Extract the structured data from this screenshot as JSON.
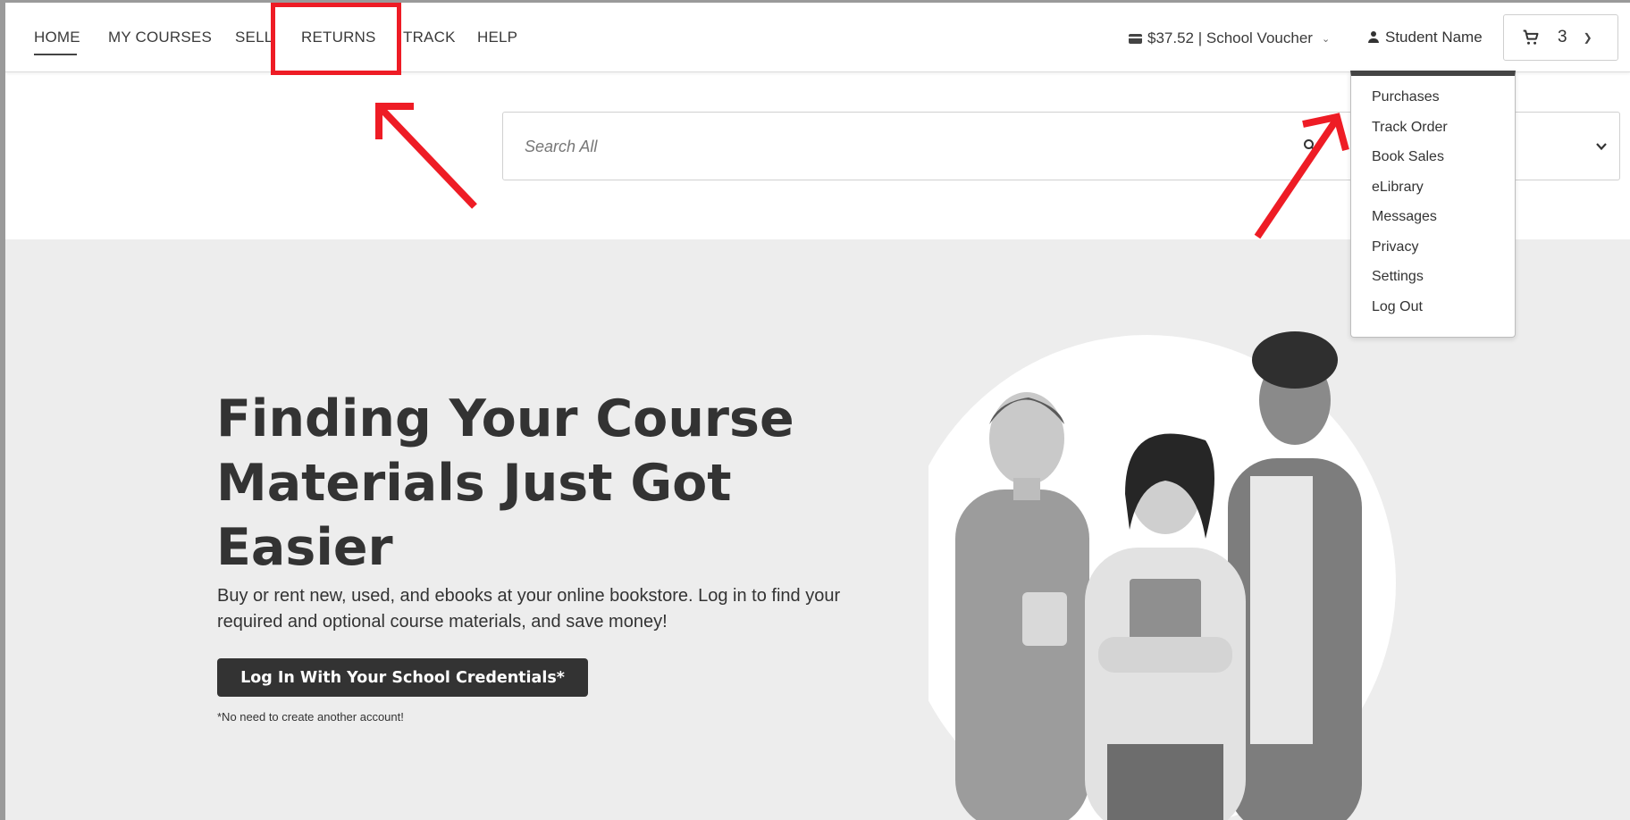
{
  "nav": {
    "items": [
      {
        "label": "HOME"
      },
      {
        "label": "MY COURSES"
      },
      {
        "label": "SELL"
      },
      {
        "label": "RETURNS"
      },
      {
        "label": "TRACK"
      },
      {
        "label": "HELP"
      }
    ],
    "active": "HOME"
  },
  "account": {
    "voucher_label": "$37.52 | School Voucher",
    "user_name": "Student Name",
    "cart_count": "3",
    "icons": [
      "card-icon",
      "person-icon",
      "cart-icon",
      "chevron-down-icon"
    ]
  },
  "user_menu": {
    "items": [
      "Purchases",
      "Track Order",
      "Book Sales",
      "eLibrary",
      "Messages",
      "Privacy",
      "Settings",
      "Log Out"
    ]
  },
  "search": {
    "placeholder": "Search All",
    "icon": "search-icon"
  },
  "hero": {
    "title": "Finding Your Course Materials Just Got Easier",
    "subtitle": "Buy or rent new, used, and ebooks at your online bookstore. Log in to find your required and optional course materials, and save money!",
    "button_label": "Log In With Your School Credentials*",
    "footnote": "*No need to create another account!"
  },
  "annotations": {
    "color": "#ee1c25",
    "highlighted": "RETURNS"
  },
  "colors": {
    "annotation": "#ee1c25",
    "hero_bg": "#ededed",
    "button_bg": "#333333"
  }
}
